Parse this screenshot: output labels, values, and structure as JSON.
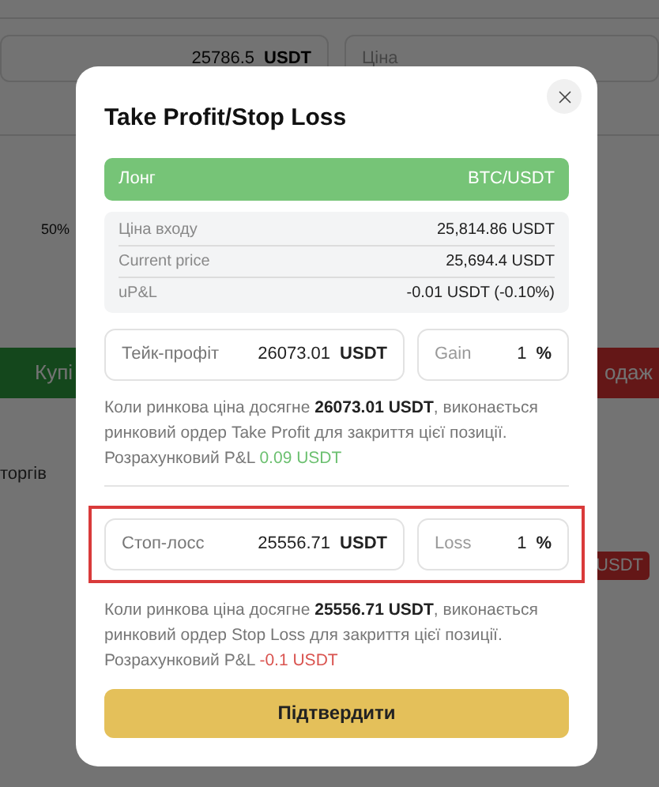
{
  "background": {
    "amount_field": {
      "value": "25786.5",
      "unit": "USDT"
    },
    "price_field": {
      "placeholder": "Ціна"
    },
    "slider_label": "50%",
    "buy_button": "Купі",
    "sell_button": "одаж",
    "tab": "торгів",
    "badge": "USDT"
  },
  "dialog": {
    "title": "Take Profit/Stop Loss",
    "position": {
      "side": "Лонг",
      "pair": "BTC/USDT"
    },
    "info": [
      {
        "label": "Ціна входу",
        "value": "25,814.86 USDT"
      },
      {
        "label": "Current price",
        "value": "25,694.4 USDT"
      },
      {
        "label": "uP&L",
        "value": "-0.01 USDT (-0.10%)"
      }
    ],
    "orders": [
      {
        "label": "Тейк-профіт",
        "value": "26073.01",
        "unit": "USDT",
        "pct_label": "Gain",
        "pct": "1",
        "pct_unit": "%",
        "highlighted": false,
        "note": "Коли ринкова ціна досягне **26073.01 USDT**, виконається ринковий ордер Take Profit для закриття цієї позиції.",
        "pnl_label": "Розрахунковий P&L",
        "pnl": "0.09 USDT",
        "positive": true
      },
      {
        "label": "Стоп-лосс",
        "value": "25556.71",
        "unit": "USDT",
        "pct_label": "Loss",
        "pct": "1",
        "pct_unit": "%",
        "highlighted": true,
        "note": "Коли ринкова ціна досягне **25556.71 USDT**, виконається ринковий ордер Stop Loss для закриття цієї позиції.",
        "pnl_label": "Розрахунковий P&L",
        "pnl": "-0.1 USDT",
        "positive": false
      }
    ],
    "confirm_button": "Підтвердити"
  }
}
